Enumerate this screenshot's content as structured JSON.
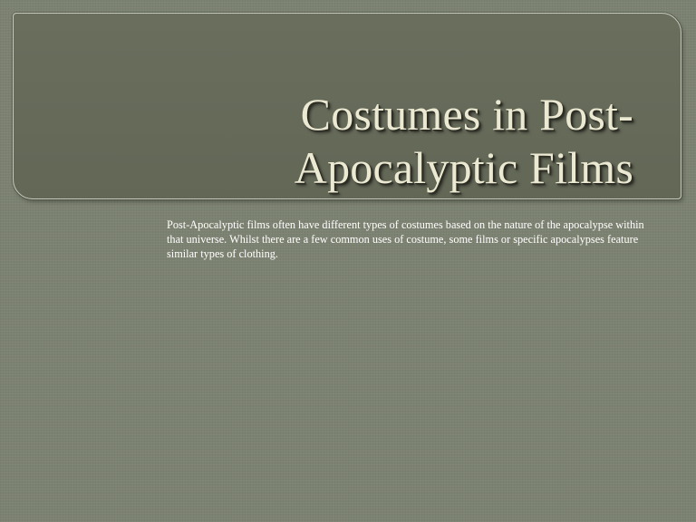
{
  "slide": {
    "title_lines": [
      "Costumes in Post-",
      "Apocalyptic Films"
    ],
    "body": "Post-Apocalyptic films often have different types of costumes based on the nature of the apocalypse within that universe. Whilst there are a few common uses of costume, some films or specific apocalypses feature similar types of clothing."
  },
  "colors": {
    "background": "#7c8271",
    "title_panel": "#676b5a",
    "title_text": "#ece9d3",
    "body_text": "#ffffff"
  }
}
